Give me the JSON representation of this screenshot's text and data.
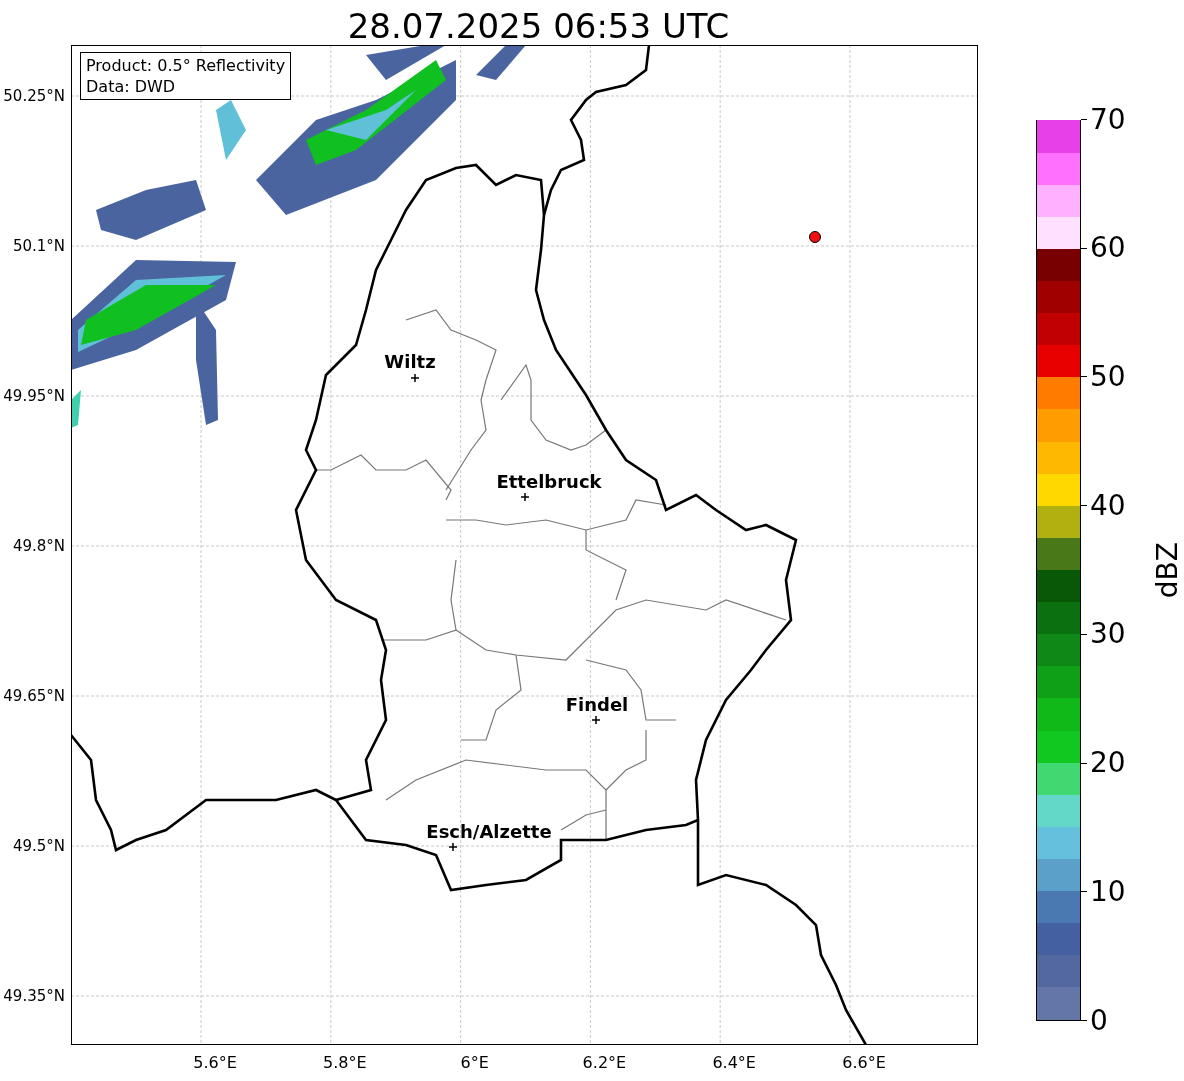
{
  "title": "28.07.2025 06:53 UTC",
  "info_box": {
    "lines": [
      "Product: 0.5° Reflectivity",
      "Data: DWD"
    ]
  },
  "map": {
    "yticks": [
      "50.25°N",
      "50.1°N",
      "49.95°N",
      "49.8°N",
      "49.65°N",
      "49.5°N",
      "49.35°N"
    ],
    "xticks": [
      "5.6°E",
      "5.8°E",
      "6°E",
      "6.2°E",
      "6.4°E",
      "6.6°E"
    ],
    "cities": [
      {
        "name": "Wiltz"
      },
      {
        "name": "Ettelbruck"
      },
      {
        "name": "Findel"
      },
      {
        "name": "Esch/Alzette"
      }
    ],
    "marker": {
      "color": "#ee1111"
    }
  },
  "colorbar": {
    "label": "dBZ",
    "ticks": [
      "70",
      "60",
      "50",
      "40",
      "30",
      "20",
      "10",
      "0"
    ],
    "bins": [
      {
        "color": "#6476a8"
      },
      {
        "color": "#5468a0"
      },
      {
        "color": "#4460a0"
      },
      {
        "color": "#4a78b0"
      },
      {
        "color": "#5aa0c8"
      },
      {
        "color": "#64c0dc"
      },
      {
        "color": "#64d8c8"
      },
      {
        "color": "#40d870"
      },
      {
        "color": "#10c820"
      },
      {
        "color": "#10b818"
      },
      {
        "color": "#10a018"
      },
      {
        "color": "#108818"
      },
      {
        "color": "#0a7010"
      },
      {
        "color": "#085808"
      },
      {
        "color": "#487818"
      },
      {
        "color": "#b0b010"
      },
      {
        "color": "#ffd800"
      },
      {
        "color": "#ffb800"
      },
      {
        "color": "#ff9c00"
      },
      {
        "color": "#ff7c00"
      },
      {
        "color": "#e80000"
      },
      {
        "color": "#c00000"
      },
      {
        "color": "#a00000"
      },
      {
        "color": "#780000"
      },
      {
        "color": "#ffe0ff"
      },
      {
        "color": "#ffb0ff"
      },
      {
        "color": "#ff70ff"
      },
      {
        "color": "#e840e8"
      }
    ]
  }
}
